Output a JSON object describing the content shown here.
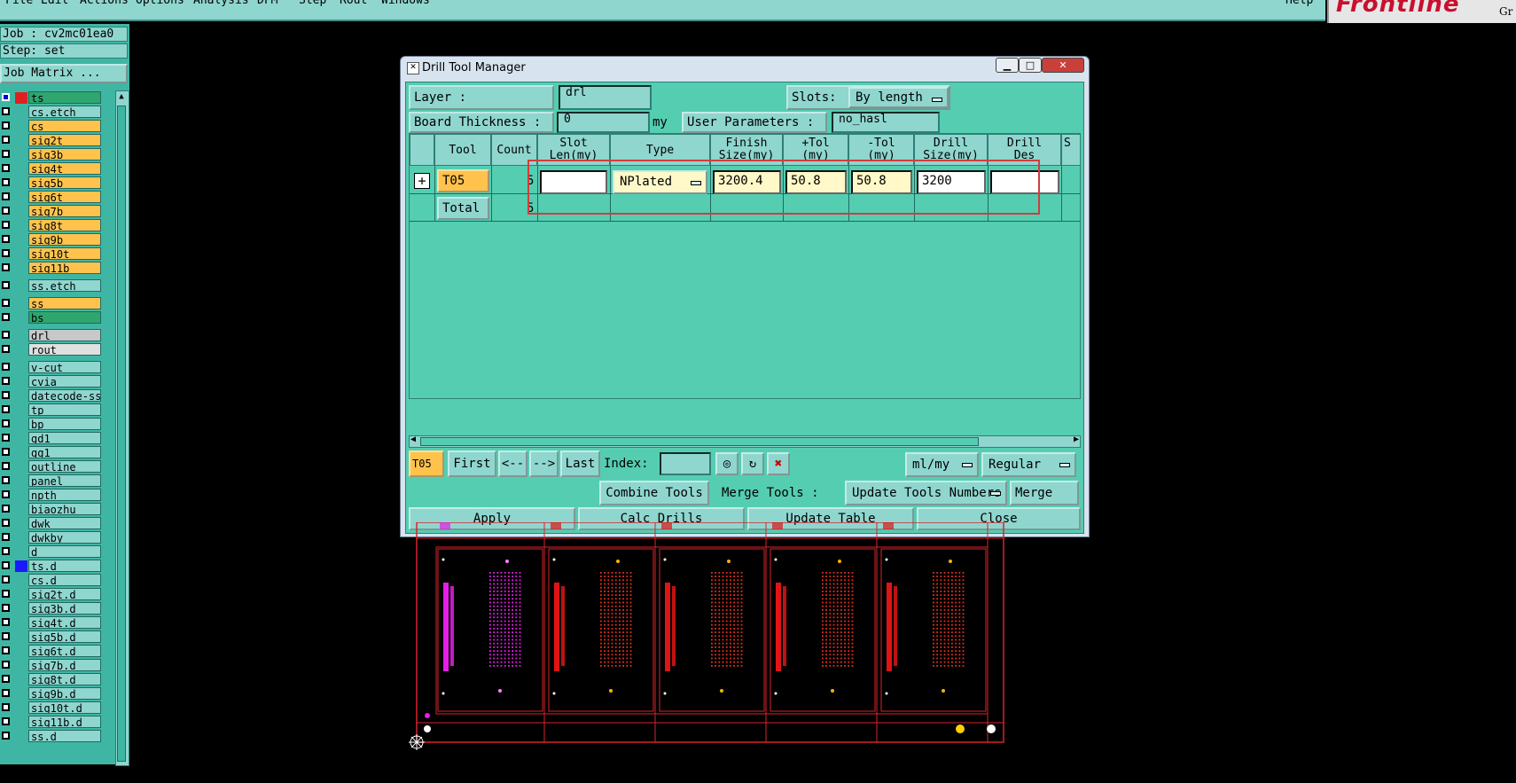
{
  "menubar": {
    "items": [
      "File",
      "Edit",
      "Actions",
      "Options",
      "Analysis",
      "DFM",
      "Step",
      "Rout",
      "Windows"
    ],
    "help": "Help"
  },
  "brand": {
    "logo": "Frontline",
    "sub": "Gr"
  },
  "left": {
    "job": "Job : cv2mc01ea0",
    "step": "Step: set",
    "job_matrix": "Job Matrix ...",
    "layers": [
      {
        "name": "ts",
        "color": "#2fa66e",
        "swatch": "#e02020",
        "marker": "#0000d0"
      },
      {
        "name": "cs.etch",
        "color": "#8fd6cf"
      },
      {
        "name": "cs",
        "color": "#ffc34d"
      },
      {
        "name": "sig2t",
        "color": "#ffc34d"
      },
      {
        "name": "sig3b",
        "color": "#ffc34d"
      },
      {
        "name": "sig4t",
        "color": "#ffc34d"
      },
      {
        "name": "sig5b",
        "color": "#ffc34d"
      },
      {
        "name": "sig6t",
        "color": "#ffc34d"
      },
      {
        "name": "sig7b",
        "color": "#ffc34d"
      },
      {
        "name": "sig8t",
        "color": "#ffc34d"
      },
      {
        "name": "sig9b",
        "color": "#ffc34d"
      },
      {
        "name": "sig10t",
        "color": "#ffc34d"
      },
      {
        "name": "sig11b",
        "color": "#ffc34d"
      },
      {
        "gap": true
      },
      {
        "name": "ss.etch",
        "color": "#8fd6cf"
      },
      {
        "gap": true
      },
      {
        "name": "ss",
        "color": "#ffc34d"
      },
      {
        "name": "bs",
        "color": "#2fa66e"
      },
      {
        "gap": true
      },
      {
        "name": "drl",
        "color": "#c8c8c8"
      },
      {
        "name": "rout",
        "color": "#e0e0e0"
      },
      {
        "gap": true
      },
      {
        "name": "v-cut",
        "color": "#8fd6cf"
      },
      {
        "name": "cvia",
        "color": "#8fd6cf"
      },
      {
        "name": "datecode-ss",
        "color": "#8fd6cf"
      },
      {
        "name": "tp",
        "color": "#8fd6cf"
      },
      {
        "name": "bp",
        "color": "#8fd6cf"
      },
      {
        "name": "gd1",
        "color": "#8fd6cf"
      },
      {
        "name": "gg1",
        "color": "#8fd6cf"
      },
      {
        "name": "outline",
        "color": "#8fd6cf"
      },
      {
        "name": "panel",
        "color": "#8fd6cf"
      },
      {
        "name": "npth",
        "color": "#8fd6cf"
      },
      {
        "name": "biaozhu",
        "color": "#8fd6cf"
      },
      {
        "name": "dwk",
        "color": "#8fd6cf"
      },
      {
        "name": "dwkby",
        "color": "#8fd6cf"
      },
      {
        "name": "d",
        "color": "#8fd6cf"
      },
      {
        "name": "ts.d",
        "color": "#8fd6cf",
        "swatch": "#1a1aff"
      },
      {
        "name": "cs.d",
        "color": "#8fd6cf"
      },
      {
        "name": "sig2t.d",
        "color": "#8fd6cf"
      },
      {
        "name": "sig3b.d",
        "color": "#8fd6cf"
      },
      {
        "name": "sig4t.d",
        "color": "#8fd6cf"
      },
      {
        "name": "sig5b.d",
        "color": "#8fd6cf"
      },
      {
        "name": "sig6t.d",
        "color": "#8fd6cf"
      },
      {
        "name": "sig7b.d",
        "color": "#8fd6cf"
      },
      {
        "name": "sig8t.d",
        "color": "#8fd6cf"
      },
      {
        "name": "sig9b.d",
        "color": "#8fd6cf"
      },
      {
        "name": "sig10t.d",
        "color": "#8fd6cf"
      },
      {
        "name": "sig11b.d",
        "color": "#8fd6cf"
      },
      {
        "name": "ss.d",
        "color": "#8fd6cf"
      }
    ]
  },
  "dialog": {
    "title": "Drill Tool Manager",
    "layer_label": "Layer          :",
    "layer_value": "drl",
    "slots_label": "Slots:",
    "slots_value": "By length",
    "thickness_label": "Board Thickness :",
    "thickness_value": "0",
    "thickness_unit": "my",
    "user_params_label": "User Parameters :",
    "user_params_value": "no_hasl",
    "headers": [
      {
        "l1": "Tool",
        "l2": ""
      },
      {
        "l1": "Count",
        "l2": ""
      },
      {
        "l1": "Slot",
        "l2": "Len(my)"
      },
      {
        "l1": "Type",
        "l2": ""
      },
      {
        "l1": "Finish",
        "l2": "Size(my)"
      },
      {
        "l1": "+Tol",
        "l2": "(my)"
      },
      {
        "l1": "-Tol",
        "l2": "(my)"
      },
      {
        "l1": "Drill",
        "l2": "Size(my)"
      },
      {
        "l1": "Drill",
        "l2": "Des"
      },
      {
        "l1": "S",
        "l2": ""
      }
    ],
    "row": {
      "tool": "T05",
      "count": "5",
      "slot_len": "",
      "type": "NPlated",
      "finish": "3200.4",
      "plus_tol": "50.8",
      "minus_tol": "50.8",
      "drill_size": "3200",
      "drill_des": ""
    },
    "total": {
      "label": "Total",
      "count": "5"
    },
    "nav": {
      "current": "T05",
      "first": "First",
      "prev": "<--",
      "next": "-->",
      "last": "Last",
      "index_label": "Index:",
      "index_value": "",
      "units": "ml/my",
      "mode": "Regular"
    },
    "tools_row": {
      "combine": "Combine Tools",
      "merge_label": "Merge Tools :",
      "update_numbers": "Update Tools Numbers",
      "merge": "Merge"
    },
    "actions": {
      "apply": "Apply",
      "calc": "Calc Drills",
      "update": "Update Table",
      "close": "Close"
    }
  }
}
